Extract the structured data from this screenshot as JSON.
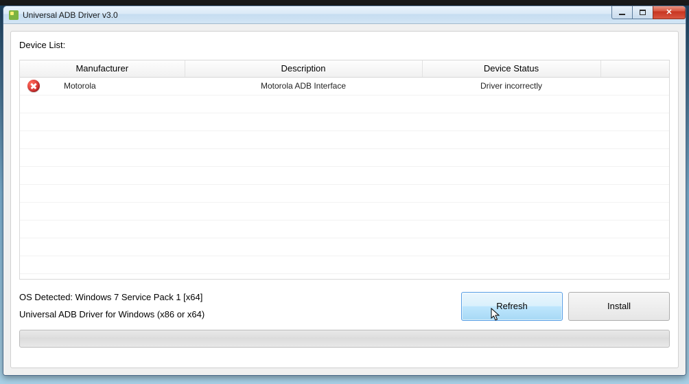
{
  "titlebar": {
    "title": "Universal ADB Driver v3.0"
  },
  "labels": {
    "device_list": "Device List:"
  },
  "table": {
    "headers": {
      "manufacturer": "Manufacturer",
      "description": "Description",
      "device_status": "Device Status"
    },
    "rows": [
      {
        "status_icon": "error-icon",
        "manufacturer": "Motorola",
        "description": "Motorola ADB Interface",
        "device_status": "Driver incorrectly"
      }
    ]
  },
  "info": {
    "os_detected": "OS Detected: Windows 7 Service Pack 1 [x64]",
    "driver_text": "Universal ADB Driver for Windows (x86 or x64)"
  },
  "buttons": {
    "refresh": "Refresh",
    "install": "Install"
  }
}
